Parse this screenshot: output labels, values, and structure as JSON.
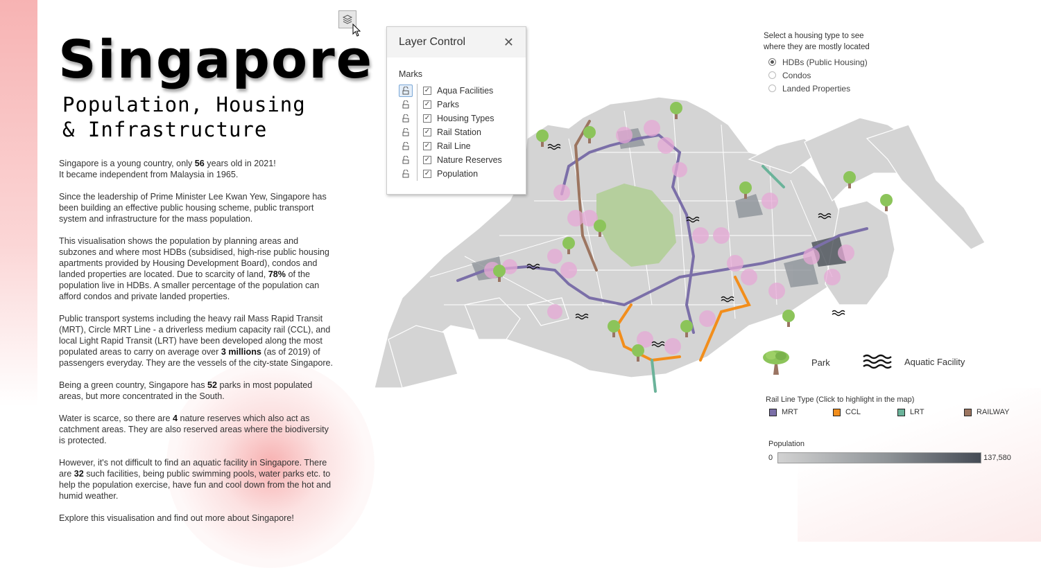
{
  "header": {
    "title": "Singapore",
    "subtitle_line1": "Population, Housing",
    "subtitle_line2": "& Infrastructure"
  },
  "story": {
    "p1_a": "Singapore is a young country, only ",
    "p1_b": "56",
    "p1_c": " years old in 2021!",
    "p1_d": "It became independent from Malaysia in 1965.",
    "p2": "Since the leadership of Prime Minister Lee Kwan Yew, Singapore has been building an effective public housing scheme, public transport system and infrastructure for the mass population.",
    "p3_a": "This visualisation shows the population by planning areas and subzones and where most HDBs (subsidised, high-rise public housing apartments provided by Housing Development Board), condos and landed properties are located. Due to scarcity of land, ",
    "p3_b": "78%",
    "p3_c": " of the population live in HDBs. A smaller percentage of the population can afford condos and private landed properties.",
    "p4_a": "Public transport systems including the heavy rail Mass Rapid Transit (MRT), Circle MRT Line - a driverless medium capacity rail (CCL), and local Light Rapid Transit (LRT) have been developed along the most populated areas to carry on average over ",
    "p4_b": "3 millions",
    "p4_c": " (as of 2019) of passengers everyday. They are the vessels of the city-state Singapore.",
    "p5_a": "Being a green country, Singapore has ",
    "p5_b": "52",
    "p5_c": " parks in most populated areas, but more concentrated in the South.",
    "p6_a": "Water is scarce, so there are ",
    "p6_b": "4",
    "p6_c": " nature reserves which also act as catchment areas. They are also reserved areas where the biodiversity is protected.",
    "p7_a": "However, it's not difficult to find an aquatic facility in Singapore. There are ",
    "p7_b": "32",
    "p7_c": " such facilities, being public swimming pools, water parks etc. to help the population exercise, have fun and cool down from the hot and humid weather.",
    "p8": "Explore this visualisation and find out more about Singapore!"
  },
  "layer_control": {
    "button_icon": "layers-icon",
    "title": "Layer Control",
    "close_icon": "close-icon",
    "section": "Marks",
    "items": [
      {
        "label": "Aqua Facilities",
        "checked": true,
        "lock_active": true
      },
      {
        "label": "Parks",
        "checked": true,
        "lock_active": false
      },
      {
        "label": "Housing Types",
        "checked": true,
        "lock_active": false
      },
      {
        "label": "Rail Station",
        "checked": true,
        "lock_active": false
      },
      {
        "label": "Rail Line",
        "checked": true,
        "lock_active": false
      },
      {
        "label": "Nature Reserves",
        "checked": true,
        "lock_active": false
      },
      {
        "label": "Population",
        "checked": true,
        "lock_active": false
      }
    ]
  },
  "housing_filter": {
    "heading_line1": "Select a housing type to see",
    "heading_line2": "where they are mostly located",
    "options": [
      {
        "label": "HDBs (Public Housing)",
        "selected": true
      },
      {
        "label": "Condos",
        "selected": false
      },
      {
        "label": "Landed Properties",
        "selected": false
      }
    ]
  },
  "icon_legend": {
    "park_label": "Park",
    "park_icon": "tree-icon",
    "aquatic_label": "Aquatic Facility",
    "aquatic_icon": "waves-icon"
  },
  "rail_legend": {
    "title": "Rail Line Type (Click to highlight in the map)",
    "items": [
      {
        "label": "MRT",
        "color": "#7b6fa8"
      },
      {
        "label": "CCL",
        "color": "#f28e1c"
      },
      {
        "label": "LRT",
        "color": "#6bb39a"
      },
      {
        "label": "RAILWAY",
        "color": "#9c7560"
      }
    ]
  },
  "population_legend": {
    "title": "Population",
    "min": "0",
    "max": "137,580",
    "color_low": "#d2d2d2",
    "color_high": "#454b55"
  },
  "map_colors": {
    "land": "#d4d4d4",
    "nature_reserve": "#b5cf9d",
    "hdb_bubble": "#e6a9d6",
    "border": "#ffffff"
  }
}
